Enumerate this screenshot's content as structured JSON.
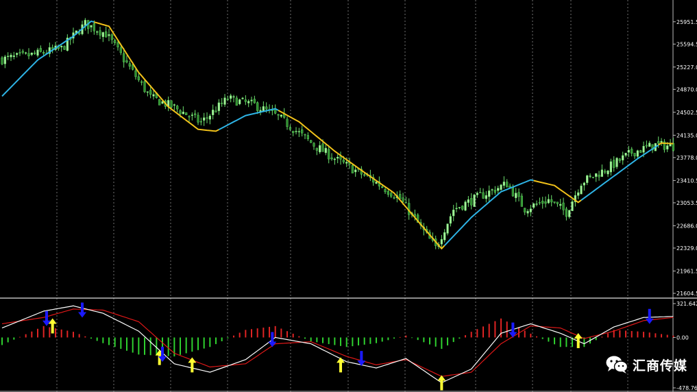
{
  "watermark": {
    "text": "汇商传媒",
    "icon": "wechat-icon"
  },
  "colors": {
    "background": "#000000",
    "bull_candle": "#a4f09a",
    "bear_candle": "#2f8f2f",
    "wick": "#6ee36e",
    "ma_up": "#2eb4e6",
    "ma_down": "#f2c21a",
    "grid": "#bdbdbd",
    "axis_text": "#ffffff",
    "hist_positive": "#e02424",
    "hist_negative": "#2fd12f",
    "macd_line": "#ffffff",
    "signal_line": "#e01818",
    "buy_arrow": "#ffff33",
    "sell_arrow": "#1a1aff"
  },
  "chart_data": [
    {
      "type": "candlestick",
      "title": "",
      "grid": "vertical-dotted",
      "ylim": [
        21604.5,
        26300
      ],
      "y_ticks": [
        "25951.5",
        "25594.5",
        "25227.0",
        "24870.0",
        "24502.5",
        "24135.0",
        "23778.0",
        "23410.5",
        "23053.5",
        "22686.0",
        "22329.0",
        "21961.5",
        "21604.5"
      ],
      "close_anchors": [
        [
          0,
          25350
        ],
        [
          10,
          25420
        ],
        [
          20,
          25520
        ],
        [
          28,
          25920
        ],
        [
          35,
          25760
        ],
        [
          50,
          24740
        ],
        [
          58,
          24580
        ],
        [
          67,
          24340
        ],
        [
          76,
          24720
        ],
        [
          85,
          24620
        ],
        [
          93,
          24430
        ],
        [
          105,
          23980
        ],
        [
          113,
          23730
        ],
        [
          125,
          23410
        ],
        [
          134,
          23120
        ],
        [
          146,
          22330
        ],
        [
          152,
          22950
        ],
        [
          161,
          23160
        ],
        [
          170,
          23360
        ],
        [
          176,
          22960
        ],
        [
          184,
          23100
        ],
        [
          190,
          22900
        ],
        [
          195,
          23380
        ],
        [
          203,
          23580
        ],
        [
          212,
          23860
        ],
        [
          220,
          23980
        ],
        [
          226,
          23960
        ]
      ],
      "ma_anchors": [
        [
          0,
          24760
        ],
        [
          12,
          25340
        ],
        [
          24,
          25720
        ],
        [
          30,
          25960
        ],
        [
          36,
          25880
        ],
        [
          46,
          25140
        ],
        [
          56,
          24590
        ],
        [
          66,
          24230
        ],
        [
          72,
          24200
        ],
        [
          82,
          24450
        ],
        [
          92,
          24560
        ],
        [
          100,
          24350
        ],
        [
          112,
          23880
        ],
        [
          122,
          23540
        ],
        [
          132,
          23210
        ],
        [
          142,
          22650
        ],
        [
          148,
          22320
        ],
        [
          158,
          22820
        ],
        [
          168,
          23230
        ],
        [
          178,
          23420
        ],
        [
          186,
          23330
        ],
        [
          194,
          23060
        ],
        [
          204,
          23410
        ],
        [
          214,
          23760
        ],
        [
          222,
          24010
        ],
        [
          226,
          24000
        ]
      ],
      "ma_turns": [
        30,
        72,
        92,
        148,
        178,
        194,
        220
      ]
    },
    {
      "type": "macd",
      "ylim": [
        -478.762,
        321.642
      ],
      "y_ticks": [
        "321.642",
        "0.00",
        "-478.762"
      ],
      "macd_anchors": [
        [
          0,
          90
        ],
        [
          14,
          250
        ],
        [
          24,
          300
        ],
        [
          34,
          230
        ],
        [
          46,
          60
        ],
        [
          58,
          -250
        ],
        [
          70,
          -330
        ],
        [
          82,
          -210
        ],
        [
          92,
          0
        ],
        [
          104,
          -60
        ],
        [
          116,
          -230
        ],
        [
          126,
          -290
        ],
        [
          136,
          -200
        ],
        [
          148,
          -430
        ],
        [
          158,
          -300
        ],
        [
          168,
          40
        ],
        [
          178,
          130
        ],
        [
          188,
          40
        ],
        [
          196,
          -60
        ],
        [
          206,
          100
        ],
        [
          216,
          190
        ],
        [
          226,
          200
        ]
      ],
      "signal_anchors": [
        [
          0,
          130
        ],
        [
          14,
          190
        ],
        [
          24,
          270
        ],
        [
          34,
          260
        ],
        [
          46,
          150
        ],
        [
          58,
          -150
        ],
        [
          70,
          -280
        ],
        [
          82,
          -250
        ],
        [
          92,
          -60
        ],
        [
          104,
          -40
        ],
        [
          116,
          -180
        ],
        [
          126,
          -260
        ],
        [
          136,
          -210
        ],
        [
          148,
          -370
        ],
        [
          158,
          -330
        ],
        [
          168,
          -60
        ],
        [
          178,
          110
        ],
        [
          188,
          90
        ],
        [
          196,
          -10
        ],
        [
          206,
          60
        ],
        [
          216,
          160
        ],
        [
          226,
          190
        ]
      ],
      "buy_signals": [
        [
          17,
          110
        ],
        [
          53,
          -190
        ],
        [
          64,
          -260
        ],
        [
          114,
          -260
        ],
        [
          148,
          -430
        ],
        [
          194,
          -30
        ]
      ],
      "sell_signals": [
        [
          15,
          180
        ],
        [
          27,
          260
        ],
        [
          54,
          -160
        ],
        [
          91,
          -20
        ],
        [
          121,
          -200
        ],
        [
          172,
          70
        ],
        [
          218,
          200
        ]
      ]
    }
  ]
}
